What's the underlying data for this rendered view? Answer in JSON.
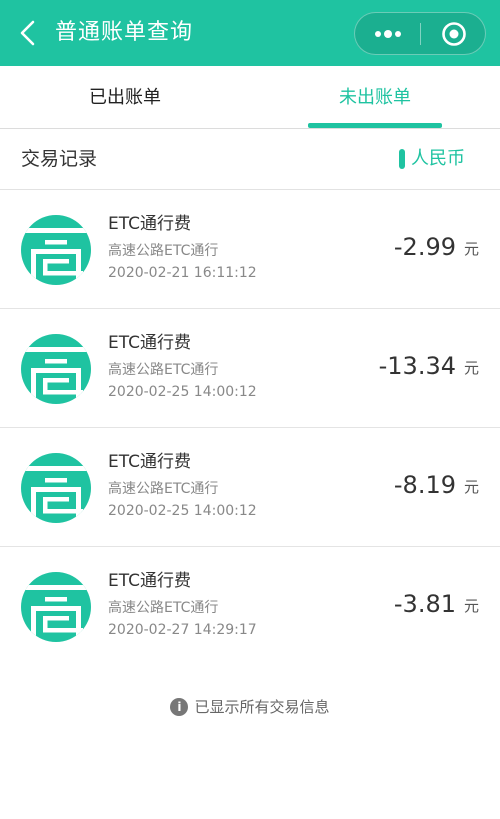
{
  "header": {
    "title": "普通账单查询",
    "back_icon": "chevron-left-icon",
    "menu_icon": "more-dots-icon",
    "close_icon": "target-circle-icon",
    "bg_color": "#1fc3a1"
  },
  "tabs": [
    {
      "label": "已出账单",
      "active": false
    },
    {
      "label": "未出账单",
      "active": true
    }
  ],
  "section": {
    "title": "交易记录",
    "currency": "人民币"
  },
  "transactions": [
    {
      "title": "ETC通行费",
      "subtitle": "高速公路ETC通行",
      "time": "2020-02-21 16:11:12",
      "amount": "-2.99",
      "unit": "元"
    },
    {
      "title": "ETC通行费",
      "subtitle": "高速公路ETC通行",
      "time": "2020-02-25 14:00:12",
      "amount": "-13.34",
      "unit": "元"
    },
    {
      "title": "ETC通行费",
      "subtitle": "高速公路ETC通行",
      "time": "2020-02-25 14:00:12",
      "amount": "-8.19",
      "unit": "元"
    },
    {
      "title": "ETC通行费",
      "subtitle": "高速公路ETC通行",
      "time": "2020-02-27 14:29:17",
      "amount": "-3.81",
      "unit": "元"
    }
  ],
  "footer": {
    "info_icon": "i",
    "text": "已显示所有交易信息"
  },
  "colors": {
    "accent": "#1fc3a1",
    "text": "#333333",
    "muted": "#888888"
  }
}
